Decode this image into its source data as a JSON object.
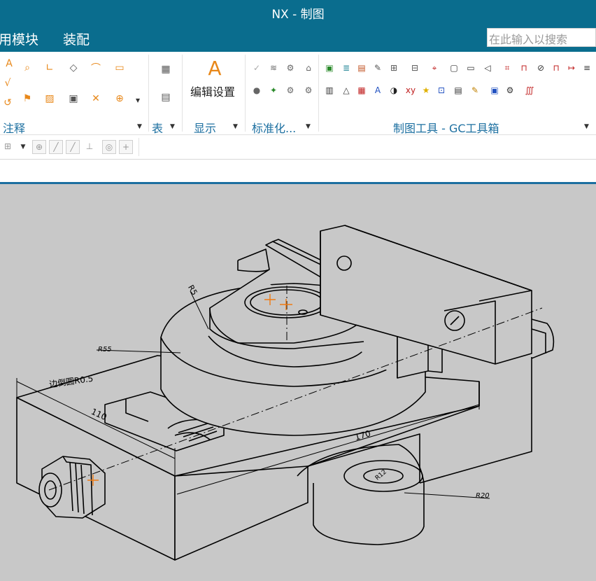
{
  "window": {
    "title": "NX - 制图"
  },
  "menu": {
    "items": [
      "用模块",
      "装配"
    ]
  },
  "search": {
    "placeholder": "在此输入以搜索"
  },
  "ribbon": {
    "groups": [
      {
        "label": "注释"
      },
      {
        "label": "表"
      },
      {
        "label": "显示"
      },
      {
        "label": "标准化..."
      },
      {
        "label": "制图工具 - GC工具箱"
      }
    ],
    "edit_settings_label": "编辑设置"
  },
  "drawing": {
    "dimensions": {
      "r5": "R5",
      "r55": "R55",
      "chamfer": "边倒圆R0.5",
      "d110": "110",
      "d170": "170",
      "r20": "R20",
      "hole": "R12"
    }
  },
  "colors": {
    "titlebar": "#0a6d8e",
    "canvas": "#c8c8c8",
    "accent": "#1c6fa0",
    "marker": "#f07a12"
  }
}
